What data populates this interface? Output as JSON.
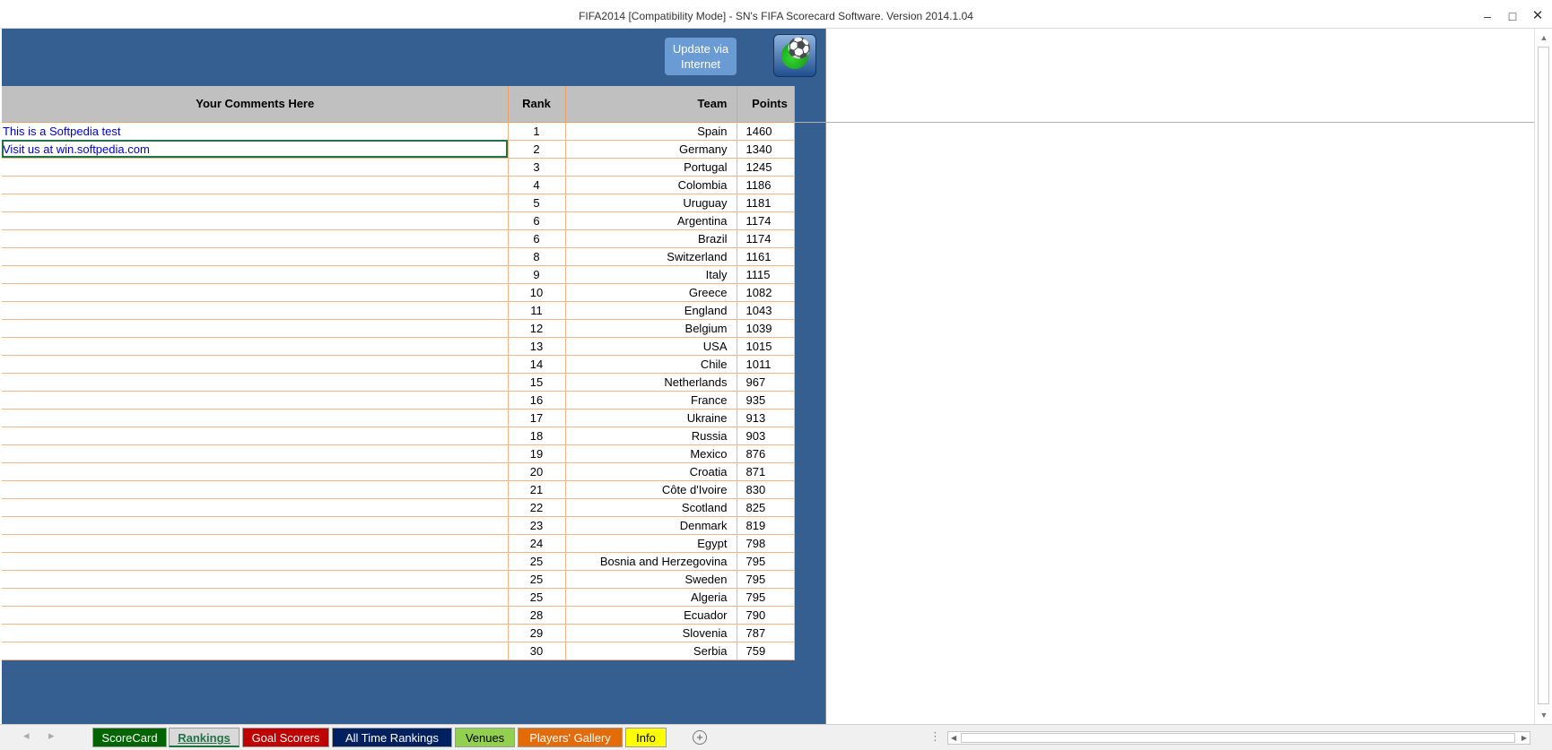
{
  "window": {
    "title": "FIFA2014  [Compatibility Mode] - SN's FIFA Scorecard Software.  Version 2014.1.04",
    "minimize_glyph": "–",
    "maximize_glyph": "□",
    "close_glyph": "✕"
  },
  "header": {
    "update_button": "Update via Internet",
    "icon_name": "soccer-player-icon"
  },
  "table": {
    "columns": [
      "Your Comments Here",
      "Rank",
      "Team",
      "Points"
    ],
    "rows": [
      {
        "comment": "This is a Softpedia test",
        "rank": "1",
        "team": "Spain",
        "points": "1460"
      },
      {
        "comment": "Visit us at win.softpedia.com",
        "rank": "2",
        "team": "Germany",
        "points": "1340"
      },
      {
        "comment": "",
        "rank": "3",
        "team": "Portugal",
        "points": "1245"
      },
      {
        "comment": "",
        "rank": "4",
        "team": "Colombia",
        "points": "1186"
      },
      {
        "comment": "",
        "rank": "5",
        "team": "Uruguay",
        "points": "1181"
      },
      {
        "comment": "",
        "rank": "6",
        "team": "Argentina",
        "points": "1174"
      },
      {
        "comment": "",
        "rank": "6",
        "team": "Brazil",
        "points": "1174"
      },
      {
        "comment": "",
        "rank": "8",
        "team": "Switzerland",
        "points": "1161"
      },
      {
        "comment": "",
        "rank": "9",
        "team": "Italy",
        "points": "1115"
      },
      {
        "comment": "",
        "rank": "10",
        "team": "Greece",
        "points": "1082"
      },
      {
        "comment": "",
        "rank": "11",
        "team": "England",
        "points": "1043"
      },
      {
        "comment": "",
        "rank": "12",
        "team": "Belgium",
        "points": "1039"
      },
      {
        "comment": "",
        "rank": "13",
        "team": "USA",
        "points": "1015"
      },
      {
        "comment": "",
        "rank": "14",
        "team": "Chile",
        "points": "1011"
      },
      {
        "comment": "",
        "rank": "15",
        "team": "Netherlands",
        "points": "967"
      },
      {
        "comment": "",
        "rank": "16",
        "team": "France",
        "points": "935"
      },
      {
        "comment": "",
        "rank": "17",
        "team": "Ukraine",
        "points": "913"
      },
      {
        "comment": "",
        "rank": "18",
        "team": "Russia",
        "points": "903"
      },
      {
        "comment": "",
        "rank": "19",
        "team": "Mexico",
        "points": "876"
      },
      {
        "comment": "",
        "rank": "20",
        "team": "Croatia",
        "points": "871"
      },
      {
        "comment": "",
        "rank": "21",
        "team": "Côte d'Ivoire",
        "points": "830"
      },
      {
        "comment": "",
        "rank": "22",
        "team": "Scotland",
        "points": "825"
      },
      {
        "comment": "",
        "rank": "23",
        "team": "Denmark",
        "points": "819"
      },
      {
        "comment": "",
        "rank": "24",
        "team": "Egypt",
        "points": "798"
      },
      {
        "comment": "",
        "rank": "25",
        "team": "Bosnia and Herzegovina",
        "points": "795"
      },
      {
        "comment": "",
        "rank": "25",
        "team": "Sweden",
        "points": "795"
      },
      {
        "comment": "",
        "rank": "25",
        "team": "Algeria",
        "points": "795"
      },
      {
        "comment": "",
        "rank": "28",
        "team": "Ecuador",
        "points": "790"
      },
      {
        "comment": "",
        "rank": "29",
        "team": "Slovenia",
        "points": "787"
      },
      {
        "comment": "",
        "rank": "30",
        "team": "Serbia",
        "points": "759"
      }
    ]
  },
  "tabs": [
    {
      "label": "ScoreCard",
      "bg": "#006400",
      "fg": "#ffffff",
      "active": false
    },
    {
      "label": "Rankings",
      "bg": "#d9d9d9",
      "fg": "#217346",
      "active": true
    },
    {
      "label": "Goal Scorers",
      "bg": "#c00000",
      "fg": "#ffffff",
      "active": false
    },
    {
      "label": "All Time Rankings",
      "bg": "#002060",
      "fg": "#ffffff",
      "active": false
    },
    {
      "label": "Venues",
      "bg": "#92d050",
      "fg": "#000000",
      "active": false
    },
    {
      "label": "Players' Gallery",
      "bg": "#e36c09",
      "fg": "#ffffff",
      "active": false
    },
    {
      "label": "Info",
      "bg": "#ffff00",
      "fg": "#000000",
      "active": false
    }
  ],
  "tabbar": {
    "add_sheet_glyph": "+",
    "prev_glyph": "◂",
    "next_glyph": "▸",
    "more_glyph": "⋮"
  },
  "colors": {
    "sheet_blue": "#365f91",
    "comment_text": "#0000cc",
    "grid_border": "#f2b483",
    "header_bg": "#c0c0c0",
    "selection": "#217346"
  }
}
